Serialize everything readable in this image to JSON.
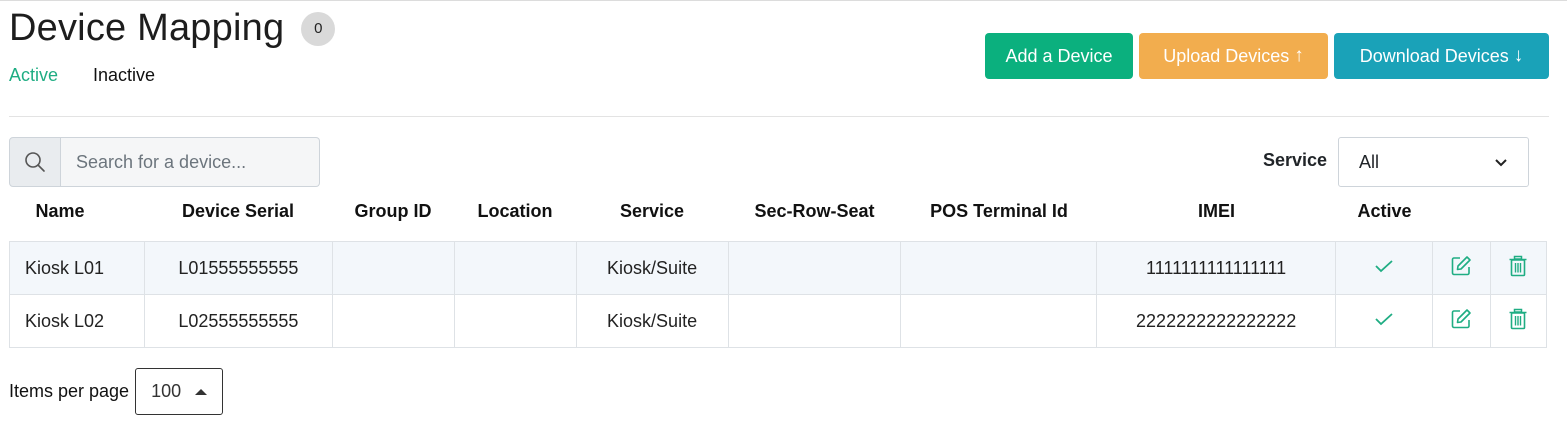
{
  "header": {
    "title": "Device Mapping",
    "count": "0"
  },
  "status_tabs": {
    "active": "Active",
    "inactive": "Inactive"
  },
  "actions": {
    "add": "Add a Device",
    "upload": "Upload Devices",
    "upload_arrow": "↑",
    "download": "Download Devices",
    "download_arrow": "↓"
  },
  "search": {
    "placeholder": "Search for a device...",
    "value": ""
  },
  "service_filter": {
    "label": "Service",
    "selected": "All"
  },
  "columns": [
    "Name",
    "Device Serial",
    "Group ID",
    "Location",
    "Service",
    "Sec-Row-Seat",
    "POS Terminal Id",
    "IMEI",
    "Active"
  ],
  "rows": [
    {
      "name": "Kiosk L01",
      "serial": "L01555555555",
      "group_id": "",
      "location": "",
      "service": "Kiosk/Suite",
      "sec_row_seat": "",
      "pos_terminal_id": "",
      "imei": "1111111111111111",
      "active": true
    },
    {
      "name": "Kiosk L02",
      "serial": "L02555555555",
      "group_id": "",
      "location": "",
      "service": "Kiosk/Suite",
      "sec_row_seat": "",
      "pos_terminal_id": "",
      "imei": "2222222222222222",
      "active": true
    }
  ],
  "pagination": {
    "label": "Items per page",
    "value": "100"
  },
  "colors": {
    "green": "#0bb07e",
    "orange": "#f2ad4e",
    "teal": "#1aa2b8",
    "active_tab": "#1fad83"
  },
  "icons": {
    "search": "search-icon",
    "active": "check-icon",
    "edit": "edit-icon",
    "delete": "trash-icon"
  }
}
